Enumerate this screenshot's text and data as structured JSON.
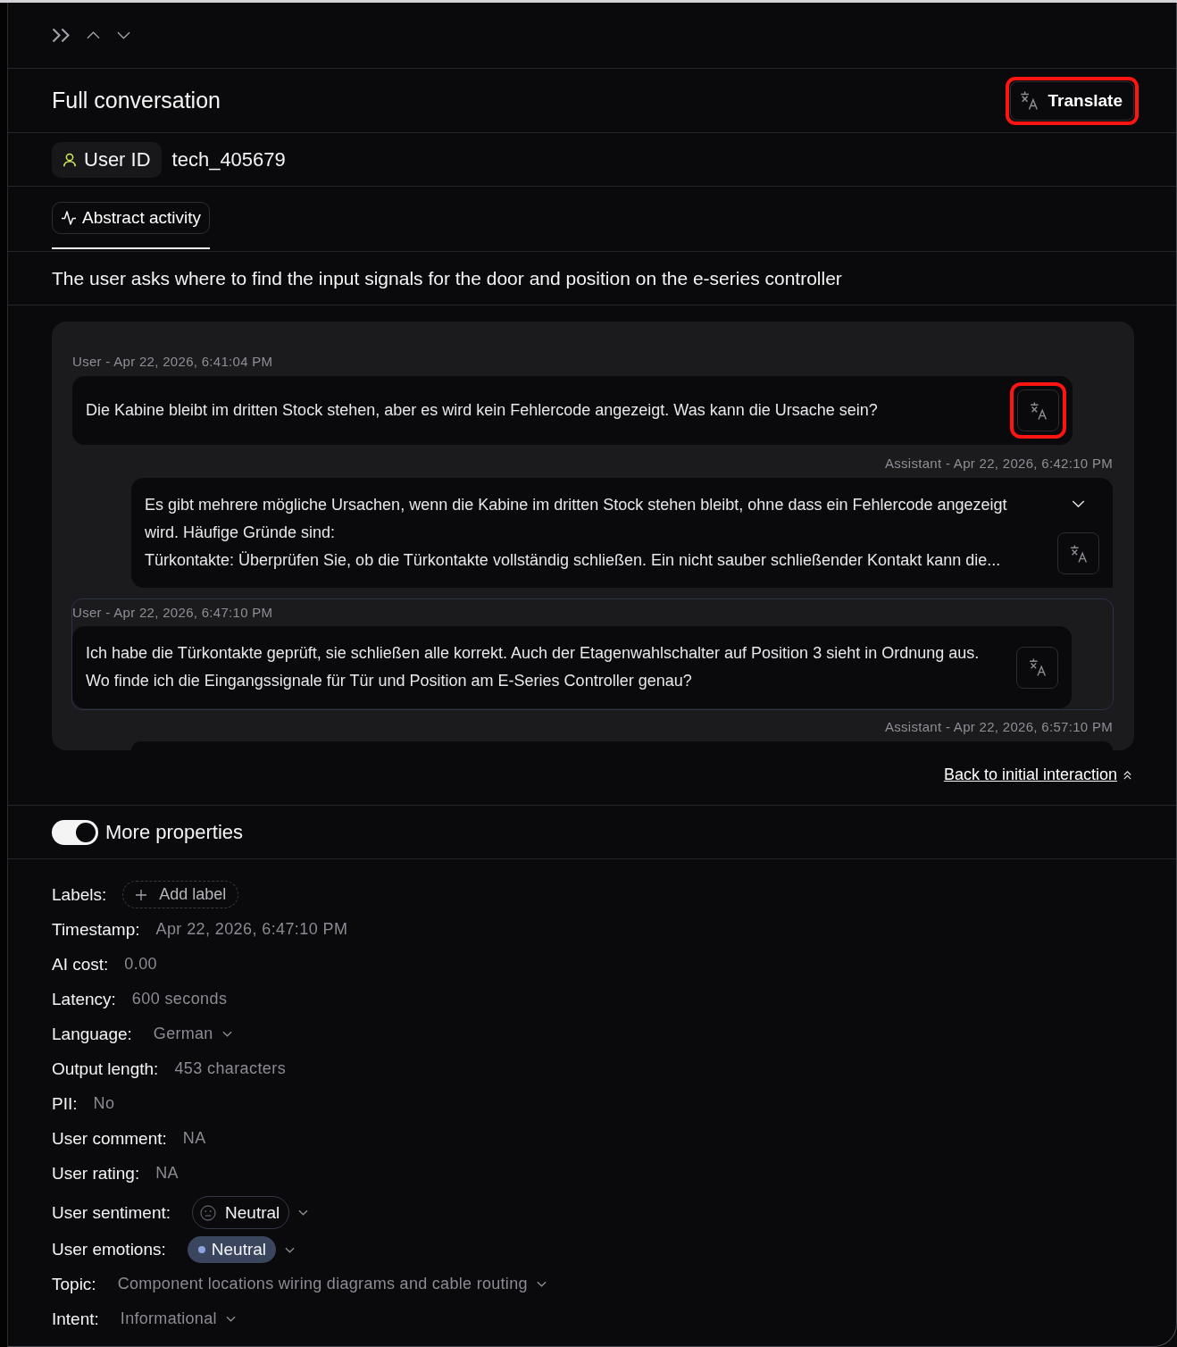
{
  "header": {
    "title": "Full conversation",
    "translate": {
      "label": "Translate",
      "highlighted": true
    }
  },
  "user_id": {
    "label": "User ID",
    "value": "tech_405679"
  },
  "tabs": [
    {
      "label": "Abstract activity",
      "selected": true
    }
  ],
  "summary": "The user asks where to find the input signals for the door and position on the e-series controller",
  "conversation": {
    "messages": [
      {
        "kind": "user",
        "meta": "User - Apr 22, 2026, 6:41:04 PM",
        "paragraphs": [
          "Die Kabine bleibt im dritten Stock stehen, aber es wird kein Fehlercode angezeigt. Was kann die Ursache sein?"
        ],
        "current": false,
        "translate_highlighted": true
      },
      {
        "kind": "assistant",
        "meta": "Assistant - Apr 22, 2026, 6:42:10 PM",
        "paragraphs": [
          "Es gibt mehrere mögliche Ursachen, wenn die Kabine im dritten Stock stehen bleibt, ohne dass ein Fehlercode angezeigt wird. Häufige Gründe sind:",
          "Türkontakte: Überprüfen Sie, ob die Türkontakte vollständig schließen. Ein nicht sauber schließender Kontakt kann die..."
        ],
        "expanded": false,
        "current": false,
        "translate_highlighted": false
      },
      {
        "kind": "user",
        "meta": "User - Apr 22, 2026, 6:47:10 PM",
        "paragraphs": [
          "Ich habe die Türkontakte geprüft, sie schließen alle korrekt. Auch der Etagenwahlschalter auf Position 3 sieht in Ordnung aus.",
          "Wo finde ich die Eingangssignale für Tür und Position am E-Series Controller genau?"
        ],
        "current": true,
        "translate_highlighted": false
      },
      {
        "kind": "assistant",
        "meta": "Assistant - Apr 22, 2026, 6:57:10 PM",
        "current": false
      }
    ]
  },
  "back_link": {
    "label": "Back to initial interaction"
  },
  "more_properties": {
    "label": "More properties",
    "on": true
  },
  "properties": [
    {
      "kind": "add_label",
      "label": "Labels:",
      "value": "Add label"
    },
    {
      "kind": "text",
      "label": "Timestamp:",
      "value": "Apr 22, 2026, 6:47:10 PM"
    },
    {
      "kind": "text",
      "label": "AI cost:",
      "value": "0.00"
    },
    {
      "kind": "text",
      "label": "Latency:",
      "value": "600 seconds"
    },
    {
      "kind": "dropdown",
      "label": "Language:",
      "value": "German"
    },
    {
      "kind": "text",
      "label": "Output length:",
      "value": "453 characters"
    },
    {
      "kind": "text",
      "label": "PII:",
      "value": "No"
    },
    {
      "kind": "text",
      "label": "User comment:",
      "value": "NA"
    },
    {
      "kind": "text",
      "label": "User rating:",
      "value": "NA"
    },
    {
      "kind": "sentiment",
      "label": "User sentiment:",
      "value": "Neutral"
    },
    {
      "kind": "emotion",
      "label": "User emotions:",
      "value": "Neutral"
    },
    {
      "kind": "dropdown",
      "label": "Topic:",
      "value": "Component locations wiring diagrams and cable routing"
    },
    {
      "kind": "dropdown",
      "label": "Intent:",
      "value": "Informational"
    }
  ]
}
